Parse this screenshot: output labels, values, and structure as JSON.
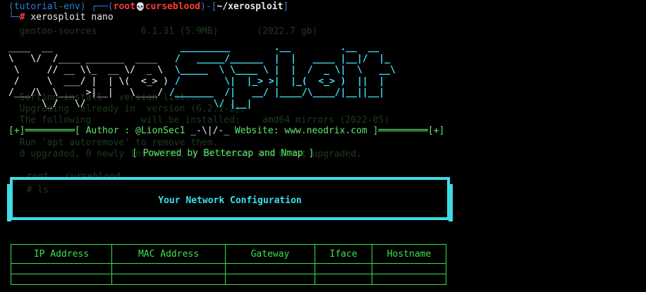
{
  "prompt": {
    "env": "(tutorial-env)",
    "user": "root",
    "skull_icon": "💀",
    "host": "curseblood",
    "path": "~/xerosploit",
    "command": "xerosploit nano"
  },
  "banner": {
    "left_rule": "[+]═════════[",
    "author_label": "Author : @LionSec1",
    "separator": "_-\\|/-_",
    "website_label": "Website: www.neodrix.com",
    "right_rule": "]═════════[+]",
    "powered_by": "[ Powered by Bettercap and Nmap ]"
  },
  "config": {
    "title": "Your Network Configuration"
  },
  "table": {
    "columns": [
      "IP Address",
      "MAC Address",
      "Gateway",
      "Iface",
      "Hostname"
    ]
  },
  "colors": {
    "accent_cyan": "#3fdce6",
    "green": "#35e24a",
    "prompt_blue": "#2f7bd8",
    "prompt_red": "#ff3b3b"
  }
}
